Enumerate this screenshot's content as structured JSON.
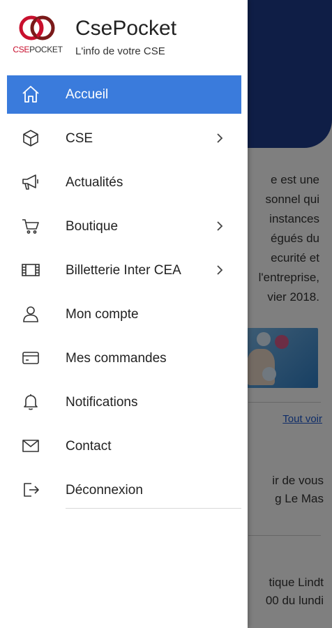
{
  "brand": {
    "app_name": "CsePocket",
    "tagline": "L'info de votre CSE",
    "logo_cse": "CSE",
    "logo_pocket": "POCKET",
    "colors": {
      "ring_red": "#c8102e",
      "ring_dark": "#7a1a1a"
    }
  },
  "menu": {
    "active_color": "#3a7bdc",
    "items": [
      {
        "label": "Accueil",
        "icon": "home-icon",
        "has_chevron": false,
        "active": true
      },
      {
        "label": "CSE",
        "icon": "cube-icon",
        "has_chevron": true,
        "active": false
      },
      {
        "label": "Actualités",
        "icon": "megaphone-icon",
        "has_chevron": false,
        "active": false
      },
      {
        "label": "Boutique",
        "icon": "cart-icon",
        "has_chevron": true,
        "active": false
      },
      {
        "label": "Billetterie Inter CEA",
        "icon": "film-icon",
        "has_chevron": true,
        "active": false
      },
      {
        "label": "Mon compte",
        "icon": "user-icon",
        "has_chevron": false,
        "active": false
      },
      {
        "label": "Mes commandes",
        "icon": "credit-card-icon",
        "has_chevron": false,
        "active": false
      },
      {
        "label": "Notifications",
        "icon": "bell-icon",
        "has_chevron": false,
        "active": false
      },
      {
        "label": "Contact",
        "icon": "envelope-icon",
        "has_chevron": false,
        "active": false
      },
      {
        "label": "Déconnexion",
        "icon": "logout-icon",
        "has_chevron": false,
        "active": false
      }
    ]
  },
  "background_page": {
    "header_color": "#1e3d8c",
    "intro_lines": [
      "e est une",
      "sonnel qui",
      "instances",
      "égués du",
      "ecurité et",
      "l'entreprise,",
      "vier 2018."
    ],
    "see_all_link": "Tout voir",
    "news_1_lines": [
      "ir de vous",
      "g Le Mas"
    ],
    "news_2_lines": [
      "tique Lindt",
      "00 du lundi"
    ]
  }
}
